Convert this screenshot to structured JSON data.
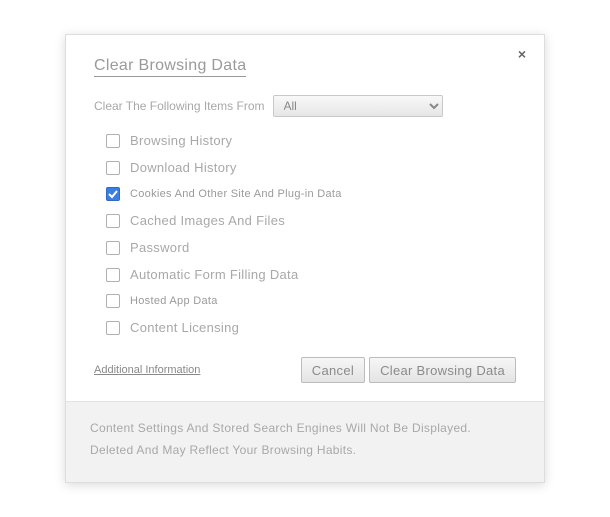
{
  "dialog": {
    "title": "Clear Browsing Data",
    "close_label": "×",
    "time_label": "Clear The Following Items From",
    "time_value": "All",
    "options": [
      {
        "label": "Browsing History",
        "checked": false,
        "styled": true
      },
      {
        "label": "Download History",
        "checked": false,
        "styled": true
      },
      {
        "label": "Cookies And Other Site And Plug-in Data",
        "checked": true,
        "styled": false
      },
      {
        "label": "Cached Images And Files",
        "checked": false,
        "styled": true
      },
      {
        "label": "Password",
        "checked": false,
        "styled": true
      },
      {
        "label": "Automatic Form Filling Data",
        "checked": false,
        "styled": true
      },
      {
        "label": "Hosted App Data",
        "checked": false,
        "styled": false
      },
      {
        "label": "Content Licensing",
        "checked": false,
        "styled": true
      }
    ],
    "info_link": "Additional Information",
    "cancel_label": "Cancel",
    "clear_label": "Clear Browsing Data",
    "footer_line1": "Content Settings And Stored Search Engines Will Not Be Displayed.",
    "footer_line2": "Deleted And May Reflect Your Browsing Habits."
  }
}
